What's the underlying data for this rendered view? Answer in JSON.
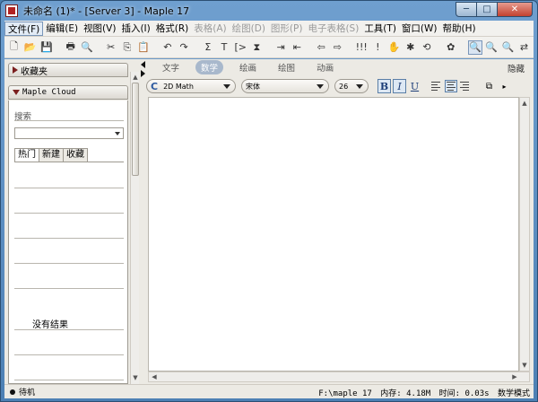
{
  "window": {
    "title": "未命名 (1)* - [Server 3] - Maple 17",
    "minimize": "─",
    "maximize": "□",
    "close": "✕"
  },
  "menubar": [
    {
      "label": "文件(F)",
      "active": true
    },
    {
      "label": "编辑(E)"
    },
    {
      "label": "视图(V)"
    },
    {
      "label": "插入(I)"
    },
    {
      "label": "格式(R)"
    },
    {
      "label": "表格(A)",
      "disabled": true
    },
    {
      "label": "绘图(D)",
      "disabled": true
    },
    {
      "label": "图形(P)",
      "disabled": true
    },
    {
      "label": "电子表格(S)",
      "disabled": true
    },
    {
      "label": "工具(T)"
    },
    {
      "label": "窗口(W)"
    },
    {
      "label": "帮助(H)"
    }
  ],
  "toolbar": {
    "icons": [
      "new-document-icon",
      "open-folder-icon",
      "save-icon",
      "print-icon",
      "preview-icon",
      "cut-icon",
      "copy-icon",
      "paste-icon",
      "undo-icon",
      "redo-icon",
      "insert-math-icon",
      "insert-text-icon",
      "execution-group-icon",
      "section-icon",
      "indent-icon",
      "outdent-icon",
      "back-icon",
      "forward-icon",
      "execute-all-icon",
      "execute-icon",
      "stop-icon",
      "debug-icon",
      "restart-icon",
      "settings-icon",
      "zoom-100-icon",
      "zoom-in-icon",
      "zoom-out-icon",
      "toggle-panel-icon"
    ],
    "glyphs": [
      "🗋",
      "📂",
      "💾",
      "🖶",
      "🔍",
      "✂",
      "⎘",
      "📋",
      "↶",
      "↷",
      "Σ",
      "T",
      "[>",
      "⧗",
      "⇥",
      "⇤",
      "⇦",
      "⇨",
      "!!!",
      "!",
      "✋",
      "✱",
      "⟲",
      "✿",
      "🔍",
      "🔍",
      "🔍",
      "⇄"
    ]
  },
  "left_panel": {
    "favorites_label": "收藏夹",
    "cloud_label": "Maple Cloud",
    "search_label": "搜索",
    "tabs": [
      "热门",
      "新建",
      "收藏"
    ],
    "no_results": "没有结果"
  },
  "doc_tabs": {
    "items": [
      "文字",
      "数学",
      "绘画",
      "绘图",
      "动画"
    ],
    "active": "数学",
    "hide_label": "隐藏"
  },
  "format_bar": {
    "mode_icon": "C",
    "mode": "2D Math",
    "font": "宋体",
    "size": "26",
    "bold": "B",
    "italic": "I",
    "underline": "U"
  },
  "status": {
    "state": "待机",
    "path": "F:\\maple 17",
    "memory": "内存: 4.18M",
    "time": "时间: 0.03s",
    "mode": "数学模式"
  }
}
